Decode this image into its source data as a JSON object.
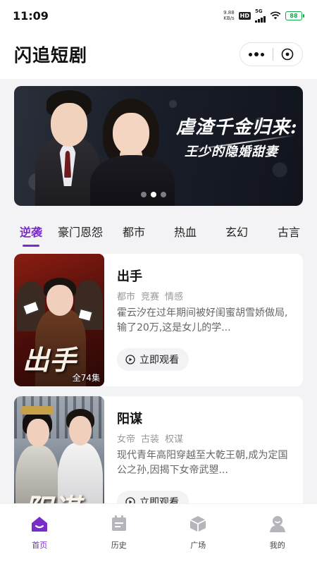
{
  "status_bar": {
    "time": "11:09",
    "net_speed_value": "9.88",
    "net_speed_unit": "KB/s",
    "hd_badge": "HD",
    "network": "5G",
    "battery": "88"
  },
  "header": {
    "title": "闪追短剧"
  },
  "banner": {
    "title_line1": "虐渣千金归来:",
    "title_line2": "王少的隐婚甜妻",
    "pages": 3,
    "active_page": 2
  },
  "tabs": [
    {
      "label": "逆袭",
      "active": true
    },
    {
      "label": "豪门恩怨",
      "active": false
    },
    {
      "label": "都市",
      "active": false
    },
    {
      "label": "热血",
      "active": false
    },
    {
      "label": "玄幻",
      "active": false
    },
    {
      "label": "古言",
      "active": false
    }
  ],
  "dramas": [
    {
      "title": "出手",
      "tags": [
        "都市",
        "竞赛",
        "情感"
      ],
      "description": "霍云汐在过年期间被好闺蜜胡雪娇做局,输了20万,这是女儿的学...",
      "episodes": "全74集",
      "poster_text": "出手",
      "watch_label": "立即观看"
    },
    {
      "title": "阳谋",
      "tags": [
        "女帝",
        "古装",
        "权谋"
      ],
      "description": "现代青年高阳穿越至大乾王朝,成为定国公之孙,因揭下女帝武曌...",
      "poster_text": "阳谋",
      "watch_label": "立即观看"
    }
  ],
  "bottom_nav": [
    {
      "label": "首页",
      "icon": "home-icon",
      "active": true
    },
    {
      "label": "历史",
      "icon": "history-icon",
      "active": false
    },
    {
      "label": "广场",
      "icon": "plaza-icon",
      "active": false
    },
    {
      "label": "我的",
      "icon": "profile-icon",
      "active": false
    }
  ],
  "colors": {
    "accent": "#7a2cc9",
    "inactive_icon": "#b5b5bb",
    "battery": "#1aa64b"
  }
}
